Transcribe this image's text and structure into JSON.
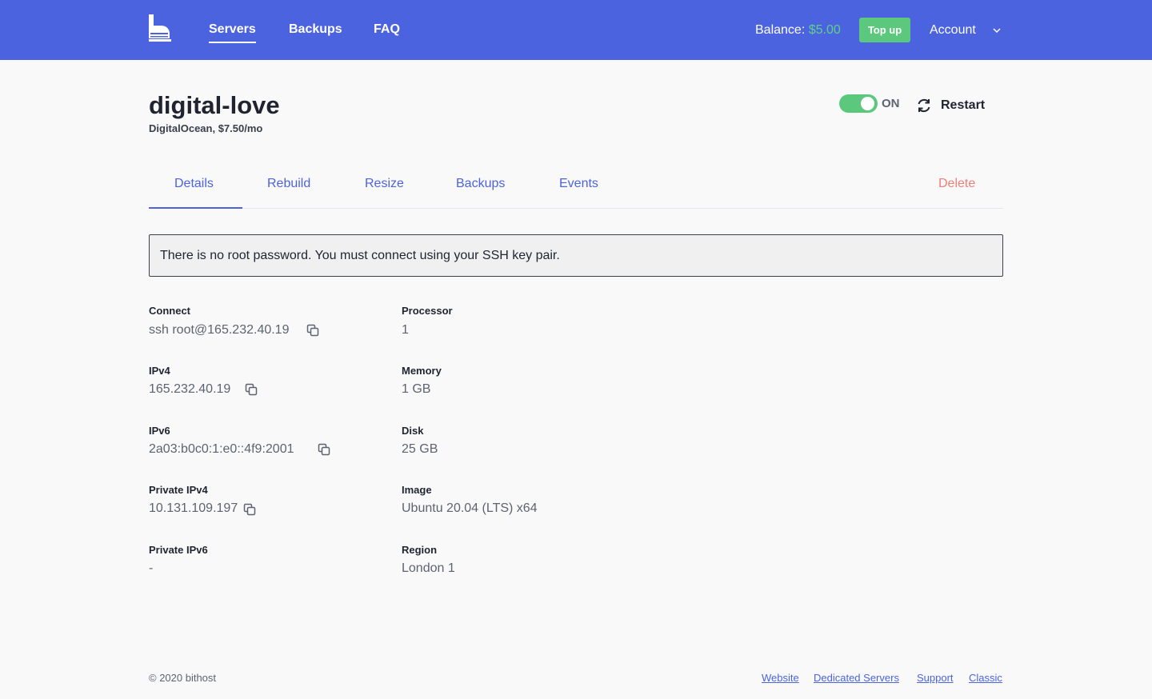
{
  "brand": {
    "logo_icon": "bithost-logo-icon",
    "accent_color": "#4c63e0"
  },
  "nav": {
    "items": [
      {
        "label": "Servers",
        "active": true
      },
      {
        "label": "Backups",
        "active": false
      },
      {
        "label": "FAQ",
        "active": false
      }
    ],
    "balance_label": "Balance:",
    "balance_amount": "$5.00",
    "topup_label": "Top up",
    "account_label": "Account"
  },
  "server": {
    "name": "digital-love",
    "subtitle": "DigitalOcean, $7.50/mo",
    "power_state": "ON",
    "power_on": true,
    "restart_label": "Restart"
  },
  "tabs": {
    "items": [
      {
        "label": "Details",
        "active": true
      },
      {
        "label": "Rebuild",
        "active": false
      },
      {
        "label": "Resize",
        "active": false
      },
      {
        "label": "Backups",
        "active": false
      },
      {
        "label": "Events",
        "active": false
      }
    ],
    "delete_label": "Delete"
  },
  "notice": "There is no root password. You must connect using your SSH key pair.",
  "details": {
    "left": [
      {
        "label": "Connect",
        "value": "ssh root@165.232.40.19",
        "copyable": true
      },
      {
        "label": "IPv4",
        "value": "165.232.40.19",
        "copyable": true
      },
      {
        "label": "IPv6",
        "value": "2a03:b0c0:1:e0::4f9:2001",
        "copyable": true
      },
      {
        "label": "Private IPv4",
        "value": "10.131.109.197",
        "copyable": true
      },
      {
        "label": "Private IPv6",
        "value": "-",
        "copyable": false
      }
    ],
    "right": [
      {
        "label": "Processor",
        "value": "1"
      },
      {
        "label": "Memory",
        "value": "1 GB"
      },
      {
        "label": "Disk",
        "value": "25 GB"
      },
      {
        "label": "Image",
        "value": "Ubuntu 20.04 (LTS) x64"
      },
      {
        "label": "Region",
        "value": "London 1"
      }
    ]
  },
  "footer": {
    "copyright": "© 2020 bithost",
    "links": [
      "Website",
      "Dedicated Servers",
      "Support",
      "Classic"
    ]
  }
}
